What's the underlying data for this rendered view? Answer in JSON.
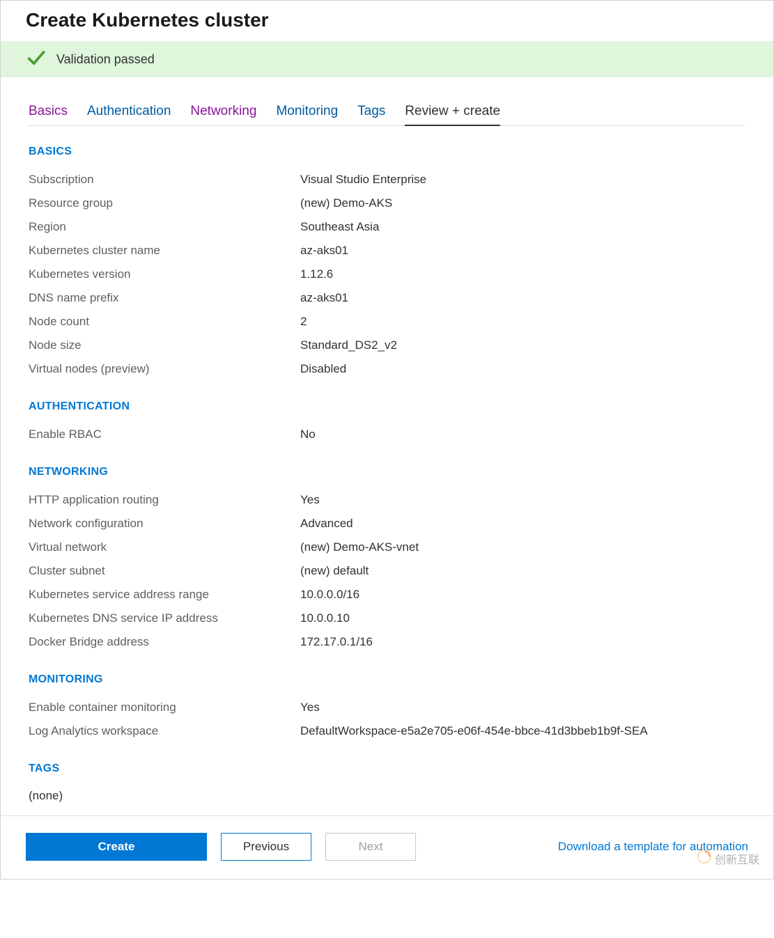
{
  "header": {
    "title": "Create Kubernetes cluster"
  },
  "validation": {
    "message": "Validation passed"
  },
  "tabs": [
    {
      "label": "Basics",
      "state": "visited"
    },
    {
      "label": "Authentication",
      "state": "link"
    },
    {
      "label": "Networking",
      "state": "visited"
    },
    {
      "label": "Monitoring",
      "state": "link"
    },
    {
      "label": "Tags",
      "state": "link"
    },
    {
      "label": "Review + create",
      "state": "active"
    }
  ],
  "sections": {
    "basics": {
      "heading": "BASICS",
      "rows": [
        {
          "label": "Subscription",
          "value": "Visual Studio Enterprise"
        },
        {
          "label": "Resource group",
          "value": "(new) Demo-AKS"
        },
        {
          "label": "Region",
          "value": "Southeast Asia"
        },
        {
          "label": "Kubernetes cluster name",
          "value": "az-aks01"
        },
        {
          "label": "Kubernetes version",
          "value": "1.12.6"
        },
        {
          "label": "DNS name prefix",
          "value": "az-aks01"
        },
        {
          "label": "Node count",
          "value": "2"
        },
        {
          "label": "Node size",
          "value": "Standard_DS2_v2"
        },
        {
          "label": "Virtual nodes (preview)",
          "value": "Disabled"
        }
      ]
    },
    "authentication": {
      "heading": "AUTHENTICATION",
      "rows": [
        {
          "label": "Enable RBAC",
          "value": "No"
        }
      ]
    },
    "networking": {
      "heading": "NETWORKING",
      "rows": [
        {
          "label": "HTTP application routing",
          "value": "Yes"
        },
        {
          "label": "Network configuration",
          "value": "Advanced"
        },
        {
          "label": "Virtual network",
          "value": "(new) Demo-AKS-vnet"
        },
        {
          "label": "Cluster subnet",
          "value": "(new) default"
        },
        {
          "label": "Kubernetes service address range",
          "value": "10.0.0.0/16"
        },
        {
          "label": "Kubernetes DNS service IP address",
          "value": "10.0.0.10"
        },
        {
          "label": "Docker Bridge address",
          "value": "172.17.0.1/16"
        }
      ]
    },
    "monitoring": {
      "heading": "MONITORING",
      "rows": [
        {
          "label": "Enable container monitoring",
          "value": "Yes"
        },
        {
          "label": "Log Analytics workspace",
          "value": "DefaultWorkspace-e5a2e705-e06f-454e-bbce-41d3bbeb1b9f-SEA"
        }
      ]
    },
    "tags": {
      "heading": "TAGS",
      "value": "(none)"
    }
  },
  "footer": {
    "create_label": "Create",
    "previous_label": "Previous",
    "next_label": "Next",
    "download_label": "Download a template for automation"
  },
  "watermark": {
    "text": "创新互联"
  }
}
